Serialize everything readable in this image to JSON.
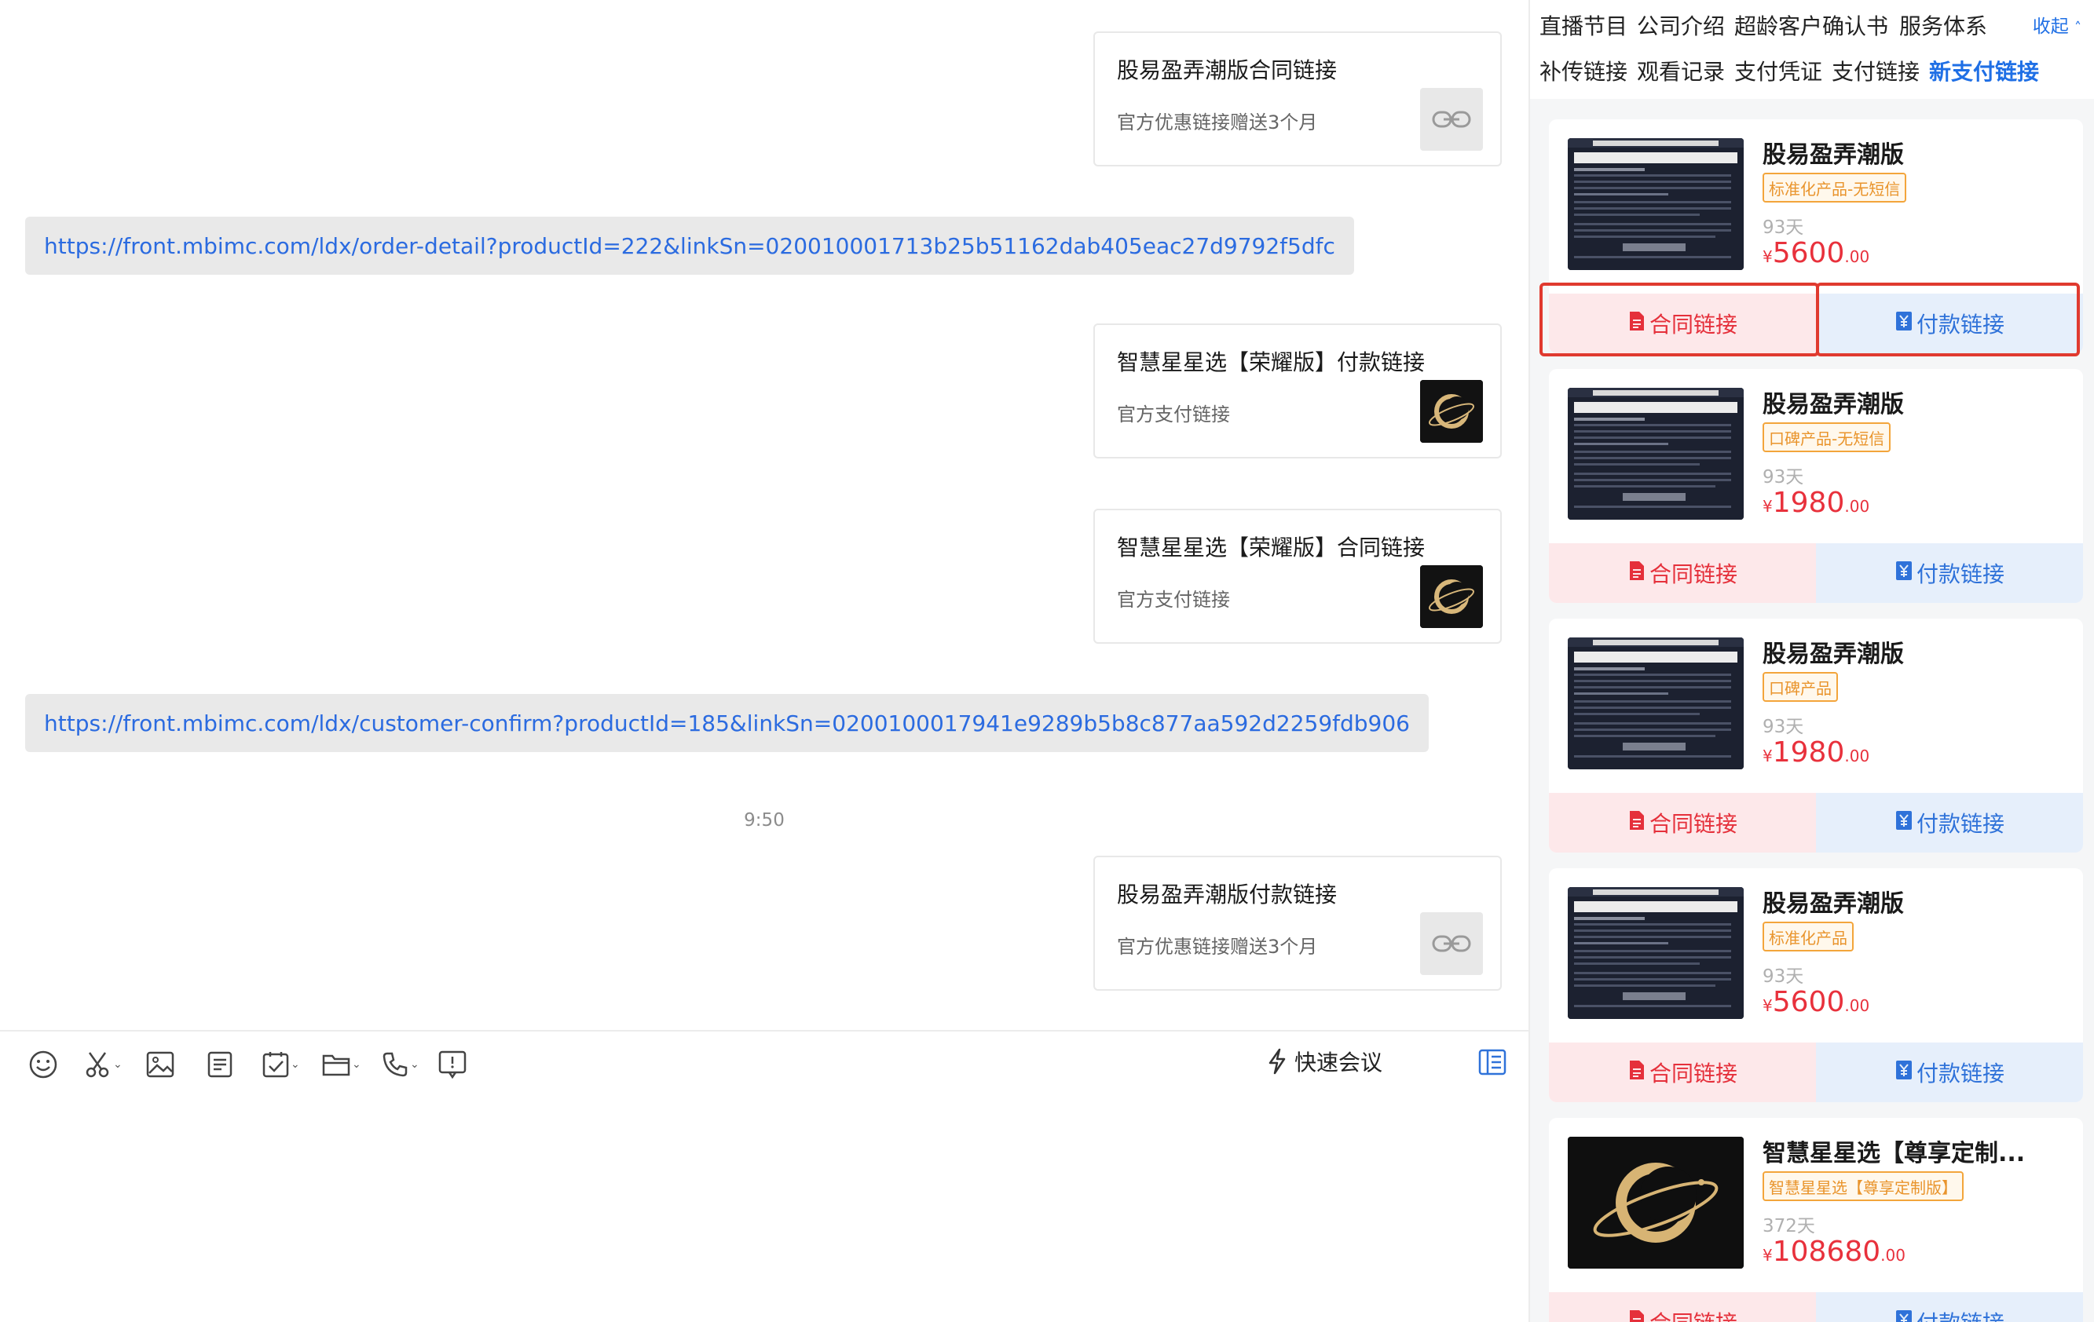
{
  "chat": {
    "messages": [
      {
        "title": "股易盈弄潮版合同链接",
        "subtitle": "官方优惠链接赠送3个月",
        "thumb": "link-icon"
      },
      {
        "url": "https://front.mbimc.com/ldx/order-detail?productId=222&linkSn=020010001713b25b51162dab405eac27d9792f5dfc"
      },
      {
        "title": "智慧星星选【荣耀版】付款链接",
        "subtitle": "官方支付链接",
        "thumb": "planet-logo"
      },
      {
        "title": "智慧星星选【荣耀版】合同链接",
        "subtitle": "官方支付链接",
        "thumb": "planet-logo"
      },
      {
        "url": "https://front.mbimc.com/ldx/customer-confirm?productId=185&linkSn=0200100017941e9289b5b8c877aa592d2259fdb906"
      },
      {
        "time": "9:50"
      },
      {
        "title": "股易盈弄潮版付款链接",
        "subtitle": "官方优惠链接赠送3个月",
        "thumb": "link-icon"
      }
    ]
  },
  "toolbar": {
    "icons": [
      "emoji-icon",
      "scissors-icon",
      "image-icon",
      "note-icon",
      "checklist-icon",
      "folder-icon",
      "phone-icon",
      "screen-share-icon"
    ],
    "meeting_label": "快速会议"
  },
  "sidebar": {
    "tabs_row1": [
      "直播节目",
      "公司介绍",
      "超龄客户确认书",
      "服务体系"
    ],
    "tabs_row2": [
      "补传链接",
      "观看记录",
      "支付凭证",
      "支付链接"
    ],
    "active_tab": "新支付链接",
    "collapse_label": "收起",
    "contract_label": "合同链接",
    "pay_label": "付款链接",
    "currency": "¥",
    "products": [
      {
        "name": "股易盈弄潮版",
        "tag": "标准化产品-无短信",
        "days": "93天",
        "price": "5600",
        "decimal": ".00",
        "image": "product-screenshot"
      },
      {
        "name": "股易盈弄潮版",
        "tag": "口碑产品-无短信",
        "days": "93天",
        "price": "1980",
        "decimal": ".00",
        "image": "product-screenshot"
      },
      {
        "name": "股易盈弄潮版",
        "tag": "口碑产品",
        "days": "93天",
        "price": "1980",
        "decimal": ".00",
        "image": "product-screenshot"
      },
      {
        "name": "股易盈弄潮版",
        "tag": "标准化产品",
        "days": "93天",
        "price": "5600",
        "decimal": ".00",
        "image": "product-screenshot"
      },
      {
        "name": "智慧星星选【尊享定制...",
        "tag": "智慧星星选【尊享定制版】",
        "days": "372天",
        "price": "108680",
        "decimal": ".00",
        "image": "planet-logo"
      }
    ]
  },
  "colors": {
    "accent": "#1f6fe5",
    "price": "#e8313c",
    "highlight": "#e03a2f",
    "tag": "#e9942c"
  }
}
